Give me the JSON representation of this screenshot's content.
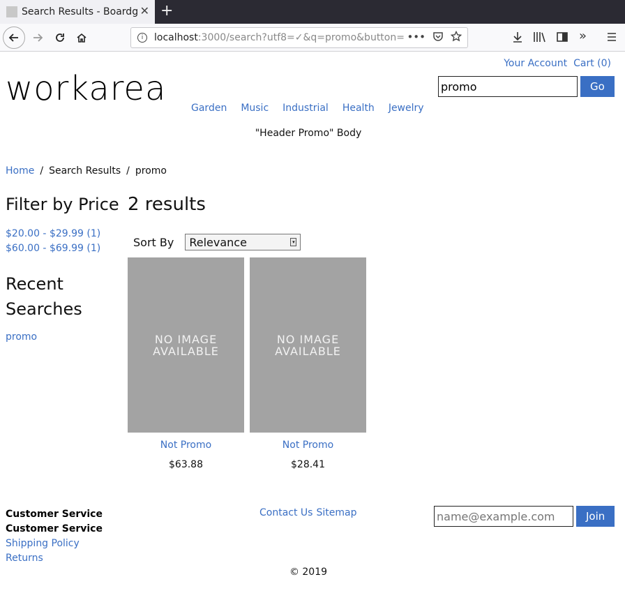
{
  "browser": {
    "tab_title": "Search Results - Boardgames",
    "tab_close": "✕",
    "new_tab": "+",
    "url_host": "localhost",
    "url_rest": ":3000/search?utf8=✓&q=promo&button="
  },
  "header": {
    "logo": "workarea",
    "account_label": "Your Account",
    "cart_label": "Cart (0)",
    "search_value": "promo",
    "search_button": "Go",
    "categories": [
      "Garden",
      "Music",
      "Industrial",
      "Health",
      "Jewelry"
    ],
    "promo": "\"Header Promo\" Body"
  },
  "breadcrumb": {
    "home": "Home",
    "sep": "/",
    "current": "Search Results",
    "query": "promo"
  },
  "sidebar": {
    "filter_title": "Filter by Price",
    "price_filters": [
      "$20.00 - $29.99 (1)",
      "$60.00 - $69.99 (1)"
    ],
    "recent_title": "Recent Searches",
    "recent_searches": [
      "promo"
    ]
  },
  "results": {
    "count_label": "2 results",
    "sort_label": "Sort By",
    "sort_value": "Relevance",
    "products": [
      {
        "image_text": "NO IMAGE AVAILABLE",
        "name": "Not Promo",
        "price": "$63.88"
      },
      {
        "image_text": "NO IMAGE AVAILABLE",
        "name": "Not Promo",
        "price": "$28.41"
      }
    ]
  },
  "footer": {
    "col_heading_1": "Customer Service",
    "col_heading_2": "Customer Service",
    "links": [
      "Shipping Policy",
      "Returns"
    ],
    "mid_links": [
      "Contact Us",
      "Sitemap"
    ],
    "email_placeholder": "name@example.com",
    "join_button": "Join",
    "copyright": "© 2019"
  },
  "colors": {
    "link": "#3a6fc4",
    "button": "#3a6fc4",
    "placeholder_image": "#a3a3a3"
  }
}
